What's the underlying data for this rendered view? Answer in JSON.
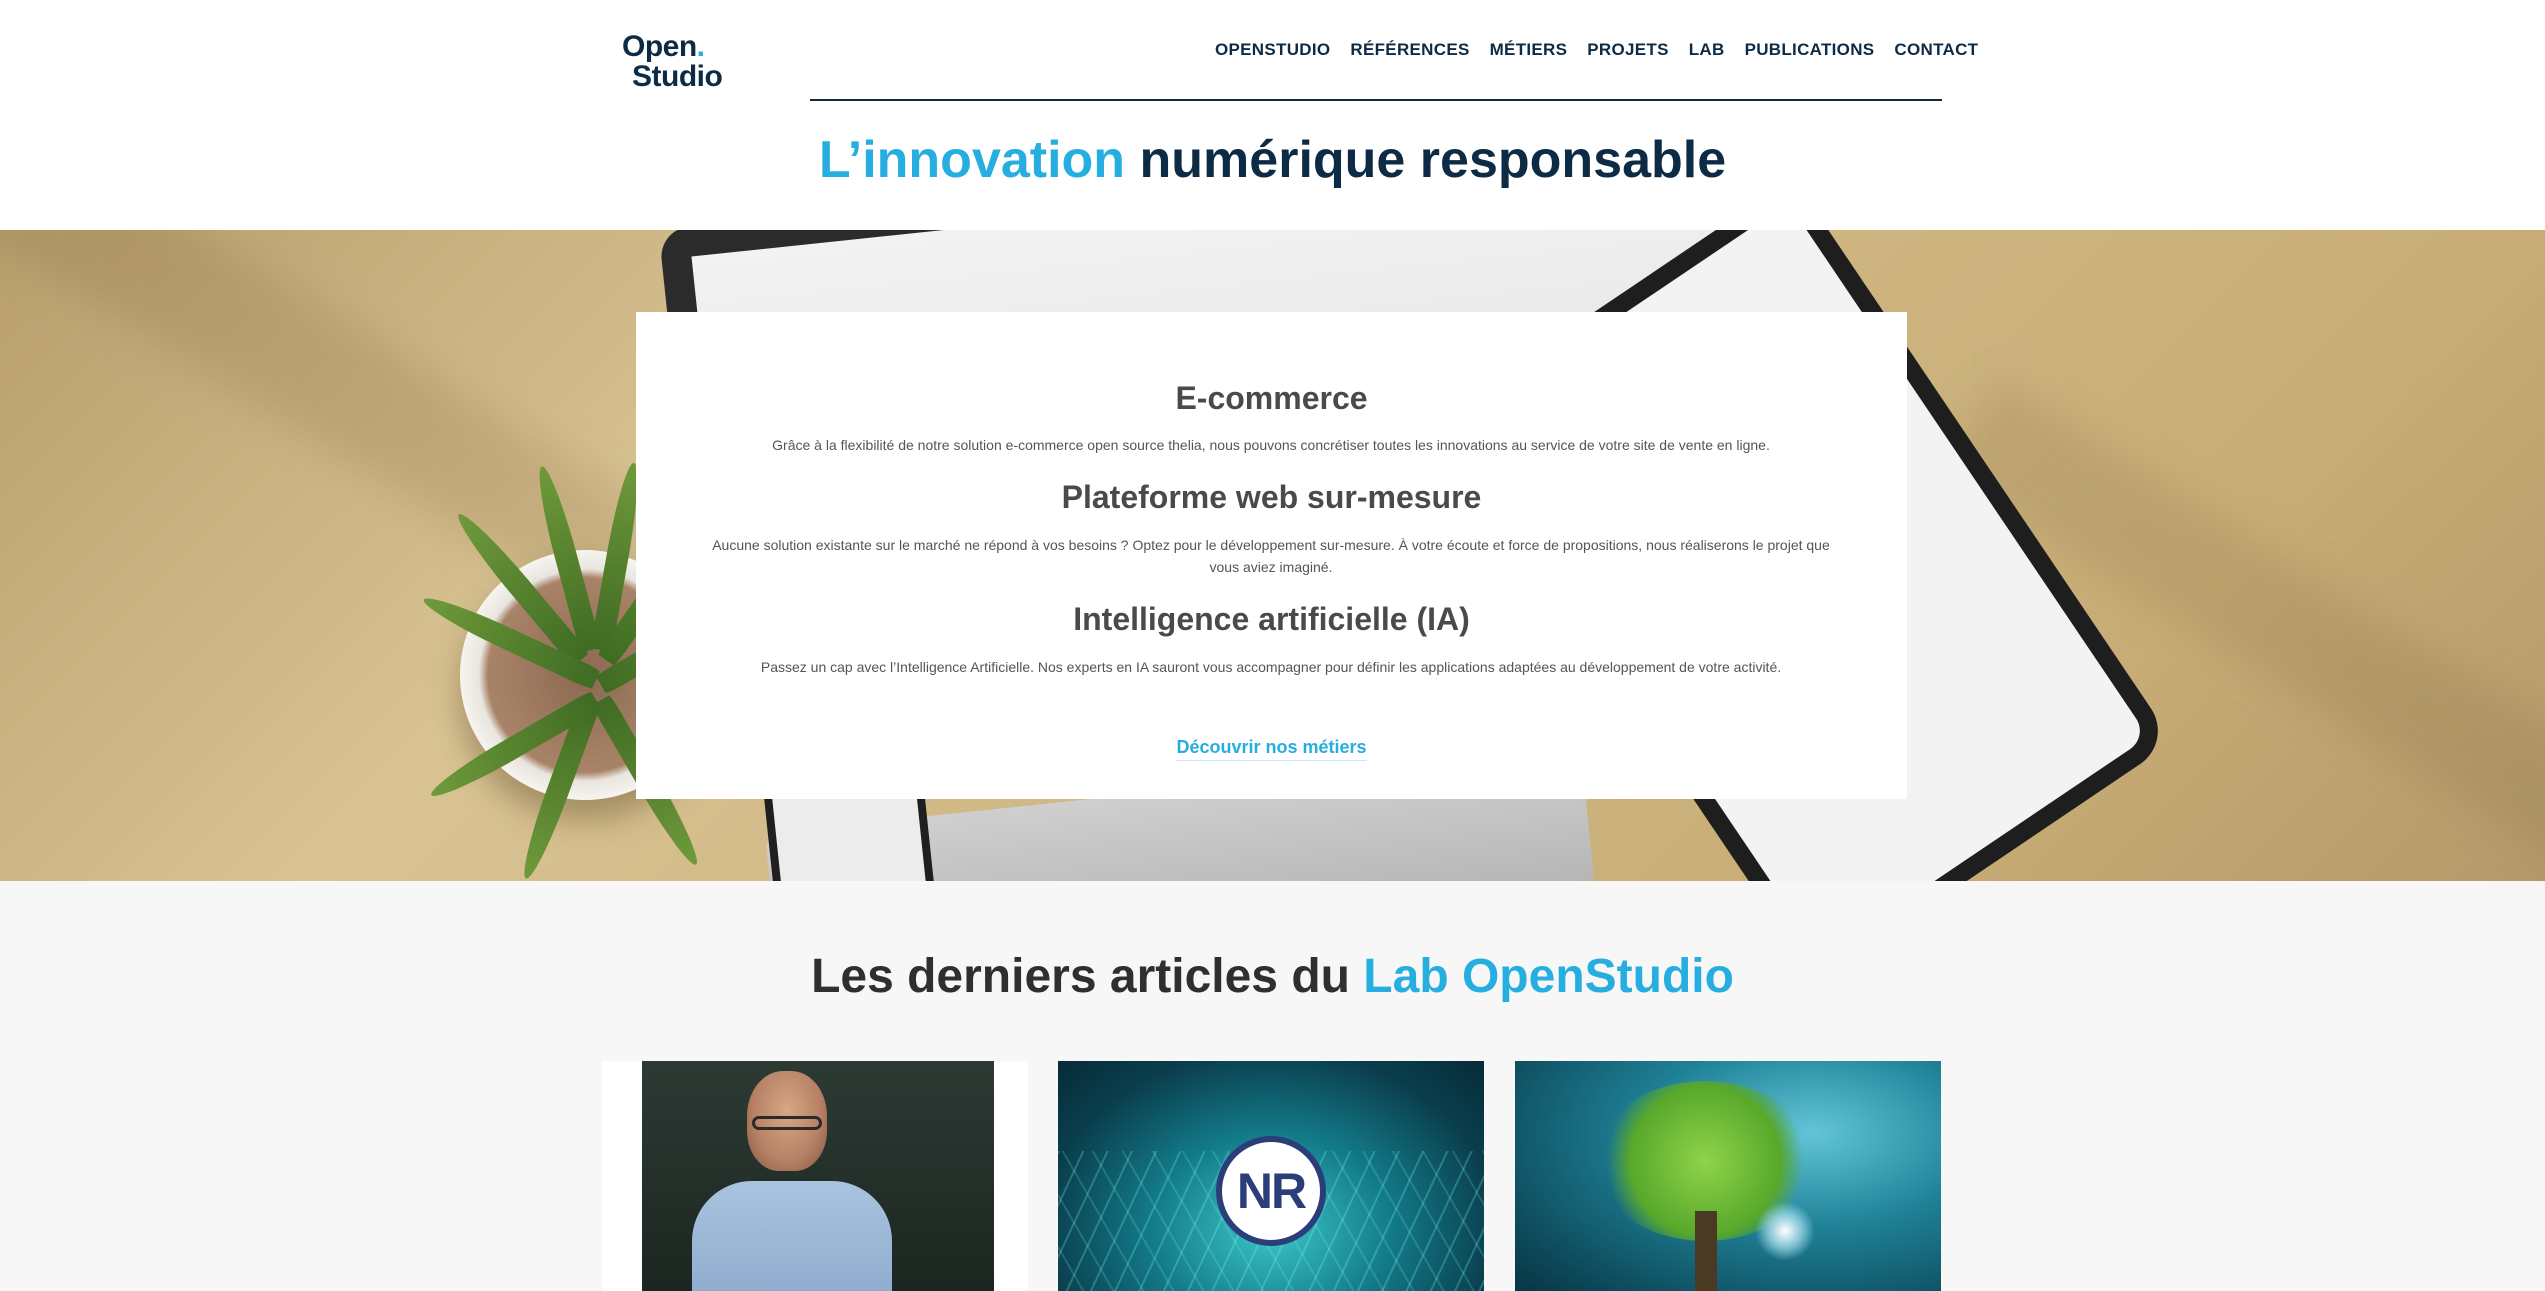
{
  "logo": {
    "line1": "Open",
    "dot": ".",
    "line2": "Studio"
  },
  "nav": {
    "items": [
      "OPENSTUDIO",
      "RÉFÉRENCES",
      "MÉTIERS",
      "PROJETS",
      "LAB",
      "PUBLICATIONS",
      "CONTACT"
    ]
  },
  "hero": {
    "title_accent": "L’innovation",
    "title_rest": " numérique responsable"
  },
  "services": {
    "items": [
      {
        "title": "E-commerce",
        "text": "Grâce à la flexibilité de notre solution e-commerce open source thelia, nous pouvons concrétiser toutes les innovations au service de votre site de vente en ligne."
      },
      {
        "title": "Plateforme web sur-mesure",
        "text": "Aucune solution existante sur le marché ne répond à vos besoins ? Optez pour le développement sur-mesure. À votre écoute et force de propositions, nous réaliserons le projet que vous aviez imaginé."
      },
      {
        "title": "Intelligence artificielle (IA)",
        "text": "Passez un cap avec l’Intelligence Artificielle. Nos experts en IA sauront vous accompagner pour définir les applications adaptées au développement de votre activité."
      }
    ],
    "cta": "Découvrir nos métiers"
  },
  "articles": {
    "title_rest": "Les derniers articles du ",
    "title_accent": "Lab OpenStudio",
    "badge_text": "NR"
  },
  "colors": {
    "accent": "#26aee0",
    "navy": "#0d2b45",
    "banner": "#d9c393"
  }
}
